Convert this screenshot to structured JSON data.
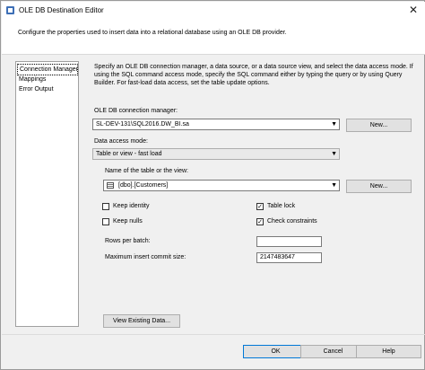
{
  "window": {
    "title": "OLE DB Destination Editor",
    "close_glyph": "✕"
  },
  "header": {
    "description": "Configure the properties used to insert data into a relational database using an OLE DB provider."
  },
  "nav": {
    "items": [
      {
        "label": "Connection Manager",
        "active": true
      },
      {
        "label": "Mappings",
        "active": false
      },
      {
        "label": "Error Output",
        "active": false
      }
    ]
  },
  "main": {
    "description": "Specify an OLE DB connection manager, a data source, or a data source view, and select the data access mode. If using the SQL command access mode, specify the SQL command either by typing the query or by using Query Builder. For fast-load data access, set the table update options.",
    "connection_label": "OLE DB connection manager:",
    "connection_value": "SL-DEV-131\\SQL2016.DW_BI.sa",
    "new_connection_button": "New...",
    "access_mode_label": "Data access mode:",
    "access_mode_value": "Table or view - fast load",
    "table_label": "Name of the table or the view:",
    "table_value": "[dbo].[Customers]",
    "new_table_button": "New...",
    "options": {
      "keep_identity": {
        "label": "Keep identity",
        "checked": false
      },
      "keep_nulls": {
        "label": "Keep nulls",
        "checked": false
      },
      "table_lock": {
        "label": "Table lock",
        "checked": true
      },
      "check_constraints": {
        "label": "Check constraints",
        "checked": true
      }
    },
    "rows_per_batch_label": "Rows per batch:",
    "rows_per_batch_value": "",
    "max_commit_label": "Maximum insert commit size:",
    "max_commit_value": "2147483647",
    "view_data_button": "View Existing Data..."
  },
  "footer": {
    "ok": "OK",
    "cancel": "Cancel",
    "help": "Help"
  },
  "glyphs": {
    "dropdown": "▼",
    "check": "✓"
  },
  "icons": [
    "table-icon",
    "dropdown-arrow-icon",
    "close-icon",
    "app-icon"
  ]
}
